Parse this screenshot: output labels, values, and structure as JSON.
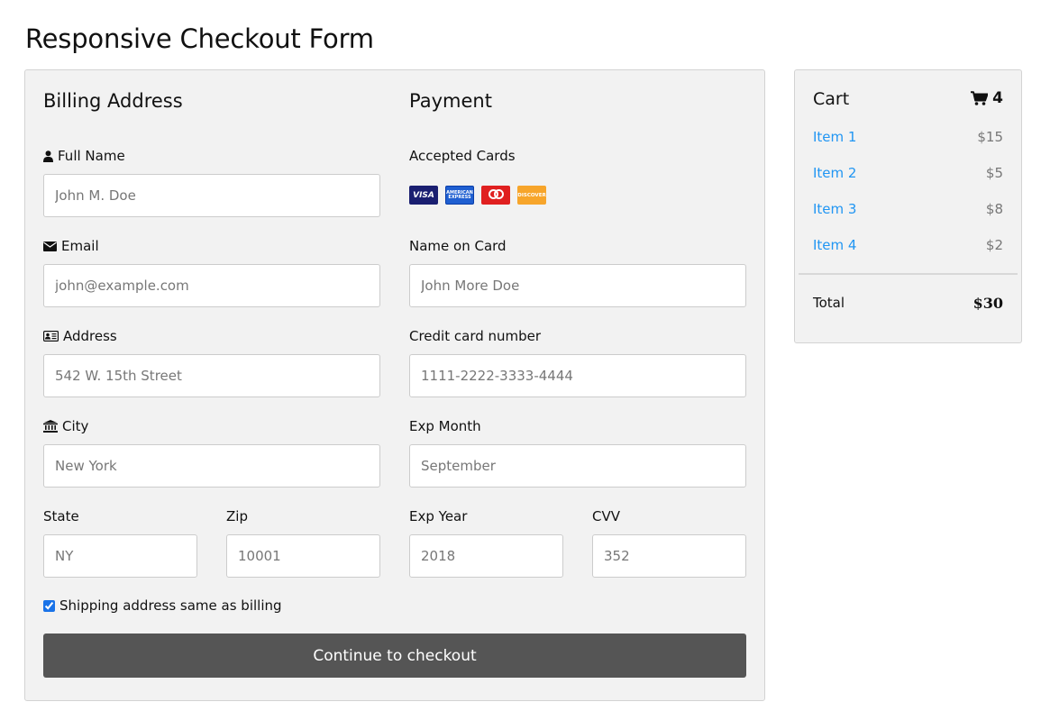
{
  "page": {
    "title": "Responsive Checkout Form"
  },
  "billing": {
    "heading": "Billing Address",
    "full_name": {
      "label": "Full Name",
      "placeholder": "John M. Doe"
    },
    "email": {
      "label": "Email",
      "placeholder": "john@example.com"
    },
    "address": {
      "label": "Address",
      "placeholder": "542 W. 15th Street"
    },
    "city": {
      "label": "City",
      "placeholder": "New York"
    },
    "state": {
      "label": "State",
      "placeholder": "NY"
    },
    "zip": {
      "label": "Zip",
      "placeholder": "10001"
    }
  },
  "payment": {
    "heading": "Payment",
    "accepted_cards_label": "Accepted Cards",
    "cards": [
      {
        "name": "visa-card-icon",
        "text": "VISA"
      },
      {
        "name": "amex-card-icon",
        "text": "AMERICAN EXPRESS"
      },
      {
        "name": "mastercard-card-icon",
        "text": ""
      },
      {
        "name": "discover-card-icon",
        "text": "DISCOVER"
      }
    ],
    "name_on_card": {
      "label": "Name on Card",
      "placeholder": "John More Doe"
    },
    "card_number": {
      "label": "Credit card number",
      "placeholder": "1111-2222-3333-4444"
    },
    "exp_month": {
      "label": "Exp Month",
      "placeholder": "September"
    },
    "exp_year": {
      "label": "Exp Year",
      "placeholder": "2018"
    },
    "cvv": {
      "label": "CVV",
      "placeholder": "352"
    }
  },
  "shipping_same": {
    "label": "Shipping address same as billing",
    "checked": true
  },
  "checkout_button": {
    "label": "Continue to checkout"
  },
  "cart": {
    "title": "Cart",
    "count": "4",
    "items": [
      {
        "label": "Item 1",
        "price": "$15"
      },
      {
        "label": "Item 2",
        "price": "$5"
      },
      {
        "label": "Item 3",
        "price": "$8"
      },
      {
        "label": "Item 4",
        "price": "$2"
      }
    ],
    "total_label": "Total",
    "total_value": "$30"
  },
  "colors": {
    "link": "#2196F3",
    "button": "#555555",
    "panel": "#f2f2f2"
  }
}
